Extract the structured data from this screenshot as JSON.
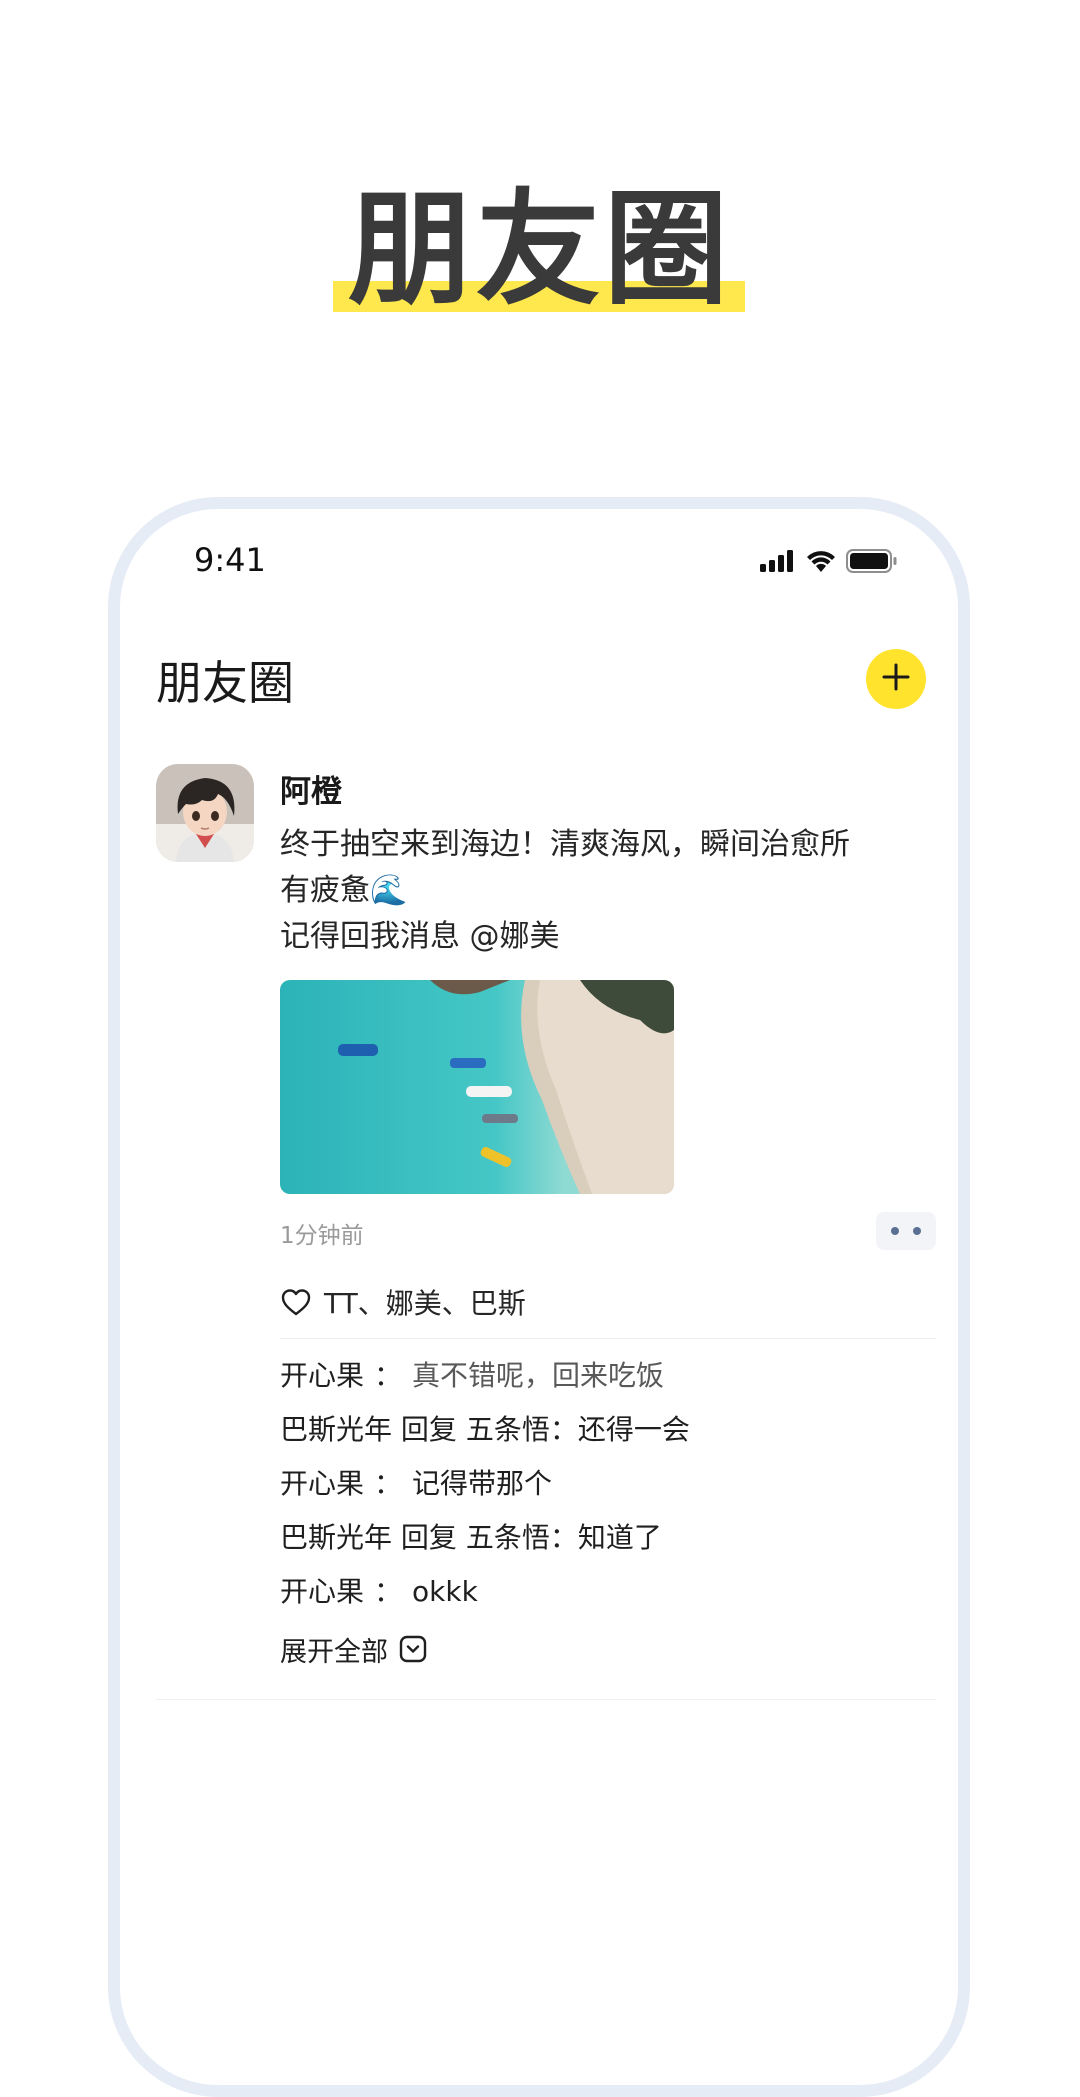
{
  "hero": {
    "title": "朋友圈"
  },
  "status_bar": {
    "time": "9:41"
  },
  "header": {
    "title": "朋友圈",
    "add_icon": "plus-icon"
  },
  "post": {
    "author": "阿橙",
    "text_lines": [
      "终于抽空来到海边！清爽海风，瞬间治愈所",
      "有疲惫🌊",
      "记得回我消息 @娜美"
    ],
    "image_alt": "aerial beach with boats",
    "timestamp": "1分钟前",
    "likes": "TT、娜美、巴斯",
    "comments": [
      {
        "user": "开心果",
        "separator": "：",
        "text": "真不错呢，回来吃饭"
      },
      {
        "user": "巴斯光年",
        "reply": "回复",
        "target": "五条悟",
        "separator": "：",
        "text": "还得一会"
      },
      {
        "user": "开心果",
        "separator": "：",
        "text": "记得带那个"
      },
      {
        "user": "巴斯光年",
        "reply": "回复",
        "target": "五条悟",
        "separator": "：",
        "text": "知道了"
      },
      {
        "user": "开心果",
        "separator": "：",
        "text": "okkk"
      }
    ],
    "expand_label": "展开全部"
  },
  "colors": {
    "accent_yellow": "#ffe32d",
    "highlight_yellow": "#ffe84d",
    "frame": "#e6ecf6",
    "more_dots": "#5b6f95"
  }
}
